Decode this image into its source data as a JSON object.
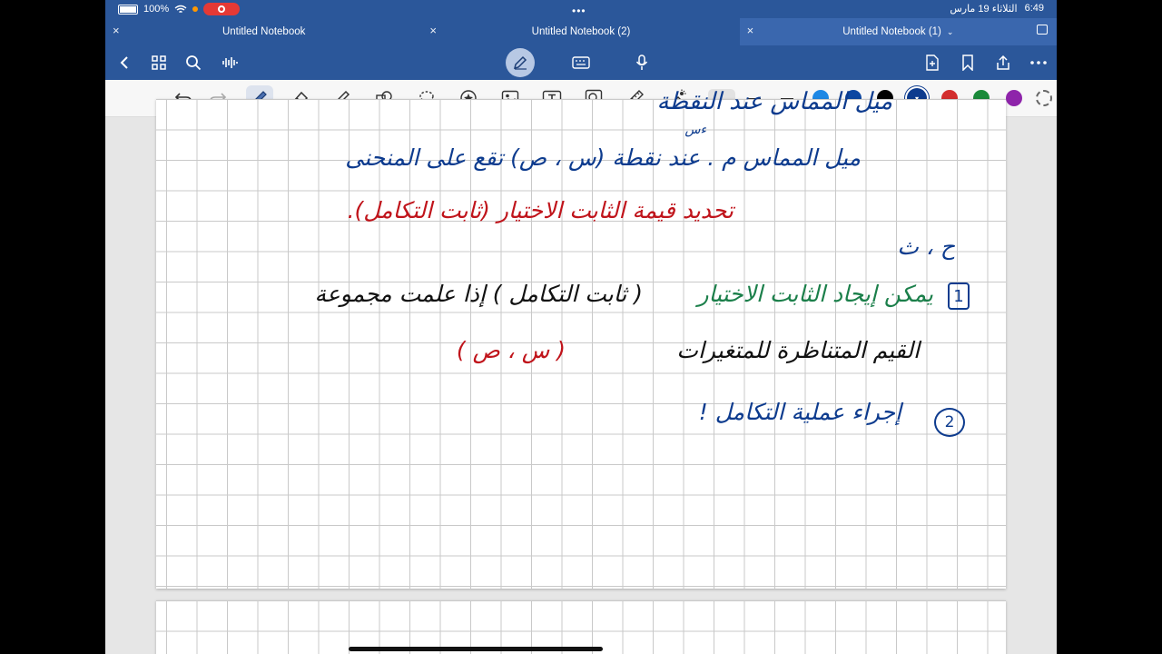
{
  "status_bar": {
    "battery": "100%",
    "time": "6:49",
    "date": "الثلاثاء 19 مارس"
  },
  "tabs": [
    {
      "title": "Untitled Notebook"
    },
    {
      "title": "Untitled Notebook (2)"
    },
    {
      "title": "Untitled Notebook (1)"
    }
  ],
  "colors": {
    "header": "#2b579a",
    "swatches": [
      "#1e88e5",
      "#0d47a1",
      "#000000",
      "#0d3b8e",
      "#d32f2f",
      "#1b8a3a",
      "#8e24aa"
    ]
  },
  "notes": {
    "line0": "ميل المماس عند النقطة",
    "line0b": "ءس",
    "line1": "ميل المماس م . عند نقطة (س ، ص) تقع على المنحنى",
    "line2": "تحديد قيمة الثابت الاختيار (ثابت التكامل).",
    "line3": "ح ، ث",
    "line4a": "1",
    "line4b": "يمكن إيجاد الثابت الاختيار",
    "line4c": "( ثابت التكامل ) إذا علمت مجموعة",
    "line5a": "القيم المتناظرة للمتغيرات",
    "line5b": "( س ، ص )",
    "line6a": "2",
    "line6b": "إجراء عملية التكامل !"
  }
}
